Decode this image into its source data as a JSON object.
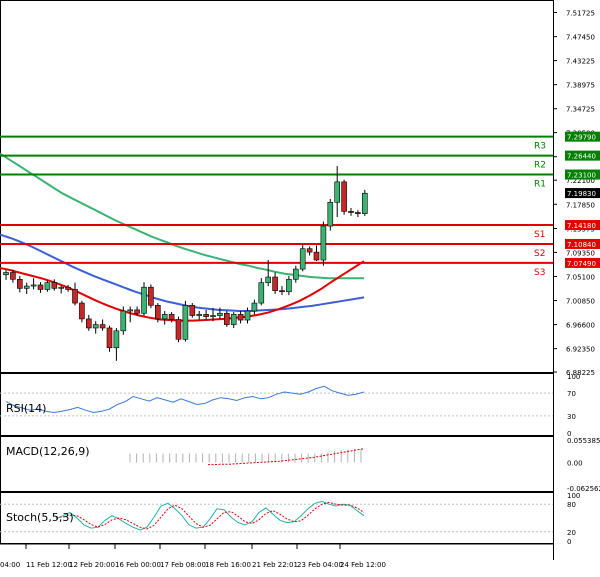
{
  "chart_data": {
    "type": "candlestick",
    "instrument_note": "",
    "main": {
      "price_ticks": [
        "7.51725",
        "7.47450",
        "7.43225",
        "7.38975",
        "7.34725",
        "7.30500",
        "7.26250",
        "7.22100",
        "7.17850",
        "7.13575",
        "7.09350",
        "7.05100",
        "7.00850",
        "6.96600",
        "6.92350",
        "6.88225"
      ],
      "ylim": [
        6.88225,
        7.5375
      ],
      "levels": [
        {
          "name": "R3",
          "value": 7.2979,
          "label": "7.29790",
          "color": "#008000"
        },
        {
          "name": "R2",
          "value": 7.2644,
          "label": "7.26440",
          "color": "#008000"
        },
        {
          "name": "R1",
          "value": 7.231,
          "label": "7.23100",
          "color": "#008000"
        },
        {
          "name": "S1",
          "value": 7.1418,
          "label": "7.14180",
          "color": "#e00000"
        },
        {
          "name": "S2",
          "value": 7.1084,
          "label": "7.10840",
          "color": "#e00000"
        },
        {
          "name": "S3",
          "value": 7.0749,
          "label": "7.07490",
          "color": "#e00000"
        }
      ],
      "current_price": {
        "value": 7.1983,
        "label": "7.19830"
      },
      "candles": [
        {
          "o": 7.054,
          "h": 7.062,
          "l": 7.045,
          "c": 7.058
        },
        {
          "o": 7.058,
          "h": 7.063,
          "l": 7.04,
          "c": 7.046
        },
        {
          "o": 7.046,
          "h": 7.052,
          "l": 7.023,
          "c": 7.03
        },
        {
          "o": 7.03,
          "h": 7.04,
          "l": 7.02,
          "c": 7.034
        },
        {
          "o": 7.034,
          "h": 7.048,
          "l": 7.028,
          "c": 7.036
        },
        {
          "o": 7.036,
          "h": 7.041,
          "l": 7.022,
          "c": 7.028
        },
        {
          "o": 7.028,
          "h": 7.044,
          "l": 7.024,
          "c": 7.04
        },
        {
          "o": 7.04,
          "h": 7.046,
          "l": 7.026,
          "c": 7.03
        },
        {
          "o": 7.03,
          "h": 7.035,
          "l": 7.021,
          "c": 7.032
        },
        {
          "o": 7.032,
          "h": 7.036,
          "l": 7.024,
          "c": 7.028
        },
        {
          "o": 7.028,
          "h": 7.04,
          "l": 7.0,
          "c": 7.004
        },
        {
          "o": 7.004,
          "h": 7.008,
          "l": 6.97,
          "c": 6.976
        },
        {
          "o": 6.976,
          "h": 6.983,
          "l": 6.955,
          "c": 6.96
        },
        {
          "o": 6.96,
          "h": 6.972,
          "l": 6.95,
          "c": 6.966
        },
        {
          "o": 6.966,
          "h": 6.975,
          "l": 6.955,
          "c": 6.96
        },
        {
          "o": 6.96,
          "h": 6.964,
          "l": 6.918,
          "c": 6.925
        },
        {
          "o": 6.925,
          "h": 6.96,
          "l": 6.902,
          "c": 6.955
        },
        {
          "o": 6.955,
          "h": 6.998,
          "l": 6.948,
          "c": 6.99
        },
        {
          "o": 6.99,
          "h": 6.998,
          "l": 6.97,
          "c": 6.992
        },
        {
          "o": 6.992,
          "h": 6.998,
          "l": 6.982,
          "c": 6.986
        },
        {
          "o": 6.986,
          "h": 7.041,
          "l": 6.982,
          "c": 7.032
        },
        {
          "o": 7.032,
          "h": 7.037,
          "l": 6.995,
          "c": 7.0
        },
        {
          "o": 7.0,
          "h": 7.004,
          "l": 6.97,
          "c": 6.976
        },
        {
          "o": 6.976,
          "h": 6.99,
          "l": 6.966,
          "c": 6.984
        },
        {
          "o": 6.984,
          "h": 6.988,
          "l": 6.97,
          "c": 6.975
        },
        {
          "o": 6.975,
          "h": 6.98,
          "l": 6.935,
          "c": 6.94
        },
        {
          "o": 6.94,
          "h": 7.008,
          "l": 6.936,
          "c": 7.0
        },
        {
          "o": 7.0,
          "h": 7.004,
          "l": 6.978,
          "c": 6.982
        },
        {
          "o": 6.982,
          "h": 6.99,
          "l": 6.975,
          "c": 6.984
        },
        {
          "o": 6.984,
          "h": 6.992,
          "l": 6.975,
          "c": 6.98
        },
        {
          "o": 6.98,
          "h": 6.995,
          "l": 6.972,
          "c": 6.982
        },
        {
          "o": 6.982,
          "h": 6.996,
          "l": 6.976,
          "c": 6.986
        },
        {
          "o": 6.986,
          "h": 6.99,
          "l": 6.962,
          "c": 6.966
        },
        {
          "o": 6.966,
          "h": 6.988,
          "l": 6.96,
          "c": 6.984
        },
        {
          "o": 6.984,
          "h": 6.99,
          "l": 6.968,
          "c": 6.974
        },
        {
          "o": 6.974,
          "h": 6.996,
          "l": 6.968,
          "c": 6.99
        },
        {
          "o": 6.99,
          "h": 7.01,
          "l": 6.984,
          "c": 7.004
        },
        {
          "o": 7.004,
          "h": 7.048,
          "l": 7.0,
          "c": 7.04
        },
        {
          "o": 7.04,
          "h": 7.08,
          "l": 7.034,
          "c": 7.05
        },
        {
          "o": 7.05,
          "h": 7.058,
          "l": 7.02,
          "c": 7.026
        },
        {
          "o": 7.026,
          "h": 7.034,
          "l": 7.018,
          "c": 7.024
        },
        {
          "o": 7.024,
          "h": 7.052,
          "l": 7.018,
          "c": 7.046
        },
        {
          "o": 7.046,
          "h": 7.07,
          "l": 7.04,
          "c": 7.064
        },
        {
          "o": 7.064,
          "h": 7.108,
          "l": 7.06,
          "c": 7.1
        },
        {
          "o": 7.1,
          "h": 7.104,
          "l": 7.088,
          "c": 7.094
        },
        {
          "o": 7.094,
          "h": 7.106,
          "l": 7.078,
          "c": 7.08
        },
        {
          "o": 7.08,
          "h": 7.148,
          "l": 7.07,
          "c": 7.14
        },
        {
          "o": 7.14,
          "h": 7.188,
          "l": 7.132,
          "c": 7.182
        },
        {
          "o": 7.182,
          "h": 7.246,
          "l": 7.156,
          "c": 7.218
        },
        {
          "o": 7.218,
          "h": 7.222,
          "l": 7.16,
          "c": 7.166
        },
        {
          "o": 7.166,
          "h": 7.172,
          "l": 7.158,
          "c": 7.164
        },
        {
          "o": 7.164,
          "h": 7.168,
          "l": 7.156,
          "c": 7.162
        },
        {
          "o": 7.162,
          "h": 7.204,
          "l": 7.158,
          "c": 7.198
        }
      ],
      "ma_green": [
        7.268,
        7.258,
        7.248,
        7.238,
        7.228,
        7.218,
        7.208,
        7.198,
        7.19,
        7.182,
        7.174,
        7.166,
        7.158,
        7.15,
        7.143,
        7.136,
        7.129,
        7.122,
        7.116,
        7.11,
        7.104,
        7.099,
        7.094,
        7.089,
        7.085,
        7.081,
        7.077,
        7.073,
        7.07,
        7.066,
        7.063,
        7.059,
        7.056,
        7.054,
        7.052,
        7.05,
        7.049,
        7.048,
        7.048,
        7.048,
        7.048,
        7.048
      ],
      "ma_blue": [
        7.125,
        7.119,
        7.112,
        7.104,
        7.095,
        7.086,
        7.077,
        7.068,
        7.06,
        7.052,
        7.045,
        7.038,
        7.031,
        7.024,
        7.018,
        7.012,
        7.007,
        7.003,
        6.999,
        6.996,
        6.994,
        6.992,
        6.991,
        6.99,
        6.99,
        6.991,
        6.992,
        6.993,
        6.995,
        6.997,
        6.999,
        7.002,
        7.005,
        7.008,
        7.011,
        7.014
      ],
      "ma_red": [
        7.066,
        7.062,
        7.057,
        7.052,
        7.047,
        7.041,
        7.034,
        7.026,
        7.017,
        7.008,
        7.0,
        6.993,
        6.987,
        6.982,
        6.978,
        6.975,
        6.974,
        6.973,
        6.973,
        6.974,
        6.975,
        6.976,
        6.978,
        6.98,
        6.983,
        6.987,
        6.993,
        7.0,
        7.008,
        7.018,
        7.029,
        7.042,
        7.054,
        7.066,
        7.078
      ],
      "x_labels": [
        "04:00",
        "11 Feb 12:00",
        "12 Feb 20:00",
        "16 Feb 00:00",
        "17 Feb 08:00",
        "18 Feb 16:00",
        "21 Feb 22:01",
        "23 Feb 04:00",
        "24 Feb 12:00"
      ]
    },
    "rsi": {
      "title": "RSI(14)",
      "ticks": [
        "100",
        "70",
        "30",
        "0"
      ],
      "ylim": [
        0,
        100
      ],
      "values": [
        55,
        48,
        44,
        40,
        42,
        38,
        36,
        38,
        41,
        45,
        40,
        36,
        38,
        42,
        50,
        55,
        64,
        60,
        56,
        62,
        58,
        54,
        60,
        55,
        50,
        52,
        58,
        62,
        60,
        57,
        62,
        64,
        60,
        62,
        68,
        72,
        70,
        68,
        72,
        78,
        82,
        74,
        70,
        66,
        68,
        72
      ]
    },
    "macd": {
      "title": "MACD(12,26,9)",
      "ticks": [
        "0.055385",
        "0.00",
        "-0.062562"
      ],
      "ylim": [
        -0.062562,
        0.055385
      ],
      "histogram": [
        0.022,
        0.022,
        0.022,
        0.022,
        0.022,
        0.022,
        0.022,
        0.022,
        0.022,
        0.022,
        0.022,
        0.022,
        0.022,
        0.022,
        0.022,
        0.022,
        0.022,
        0.022,
        0.022,
        0.022,
        0.022,
        0.022,
        0.022,
        0.022,
        0.022,
        0.022,
        0.022,
        0.022,
        0.022,
        0.022,
        0.026,
        0.028,
        0.03,
        0.032,
        0.034,
        0.034
      ],
      "signal": [
        -0.005,
        -0.005,
        -0.004,
        -0.004,
        -0.003,
        -0.002,
        -0.001,
        0.0,
        0.001,
        0.002,
        0.003,
        0.005,
        0.007,
        0.009,
        0.011,
        0.013,
        0.016,
        0.019,
        0.022,
        0.025,
        0.028,
        0.031,
        0.034
      ]
    },
    "stoch": {
      "title": "Stoch(5,5,3)",
      "ticks": [
        "100",
        "80",
        "20",
        "0"
      ],
      "ylim": [
        0,
        100
      ],
      "main_line": [
        48,
        55,
        62,
        50,
        35,
        28,
        30,
        45,
        55,
        48,
        38,
        30,
        24,
        30,
        52,
        76,
        82,
        70,
        55,
        35,
        28,
        30,
        48,
        70,
        68,
        52,
        40,
        35,
        42,
        62,
        72,
        58,
        45,
        40,
        42,
        55,
        70,
        82,
        86,
        80,
        76,
        80,
        78,
        66,
        55
      ],
      "signal_line": [
        52,
        52,
        56,
        55,
        46,
        36,
        30,
        36,
        46,
        50,
        46,
        38,
        30,
        26,
        34,
        52,
        70,
        78,
        70,
        54,
        38,
        30,
        34,
        48,
        62,
        64,
        54,
        42,
        38,
        46,
        60,
        66,
        58,
        48,
        42,
        44,
        56,
        70,
        80,
        84,
        80,
        78,
        78,
        72,
        62
      ]
    }
  }
}
